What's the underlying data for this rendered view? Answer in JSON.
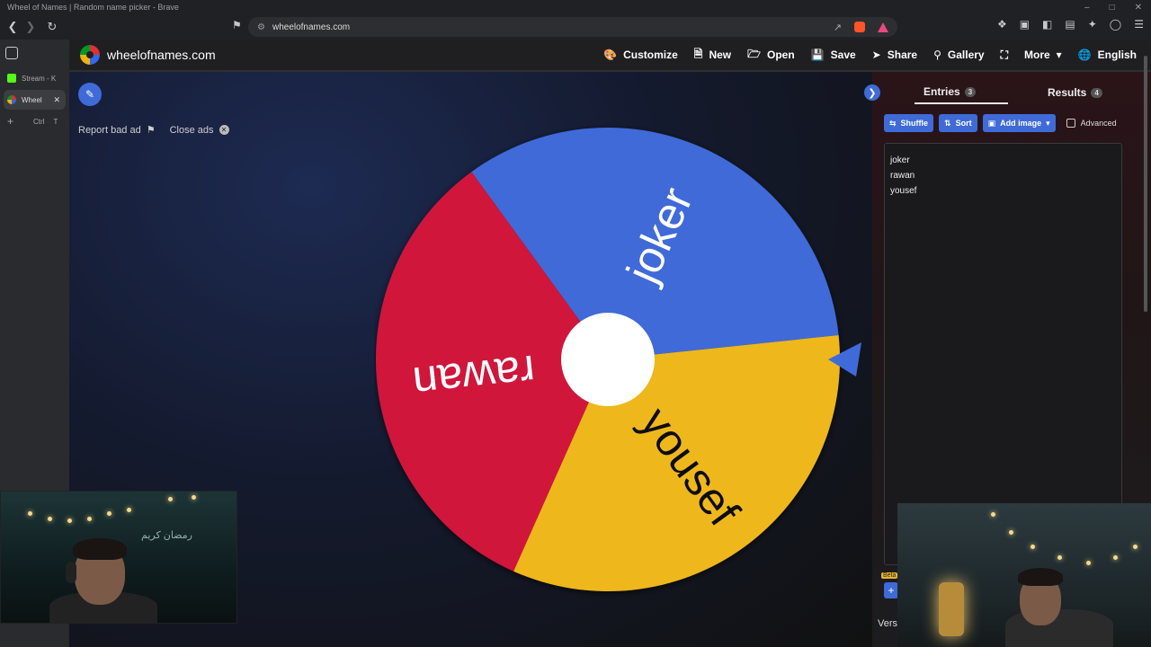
{
  "browser": {
    "window_title": "Wheel of Names | Random name picker - Brave",
    "url": "wheelofnames.com",
    "side_tabs": [
      {
        "label": "Stream - K",
        "color": "#53fc18"
      },
      {
        "label": "Wheel",
        "color": "#3369e8"
      }
    ],
    "new_tab_shortcut_ctrl": "Ctrl",
    "new_tab_shortcut_key": "T"
  },
  "site": {
    "name": "wheelofnames.com",
    "menu": [
      {
        "label": "Customize",
        "icon": "palette-icon"
      },
      {
        "label": "New",
        "icon": "file-icon"
      },
      {
        "label": "Open",
        "icon": "folder-icon"
      },
      {
        "label": "Save",
        "icon": "save-icon"
      },
      {
        "label": "Share",
        "icon": "share-icon"
      },
      {
        "label": "Gallery",
        "icon": "search-icon"
      },
      {
        "label": "More",
        "icon": "fullscreen-icon"
      },
      {
        "label": "English",
        "icon": "globe-icon"
      }
    ],
    "report_ad": "Report bad ad",
    "close_ads": "Close ads"
  },
  "wheel": {
    "segments": [
      {
        "label": "joker",
        "color": "#3f6bd8"
      },
      {
        "label": "yousef",
        "color": "#eeb71e"
      },
      {
        "label": "rawan",
        "color": "#d0143a"
      }
    ],
    "center_color": "#ffffff",
    "pointer_color": "#3f6bd8"
  },
  "panel": {
    "entries_tab": "Entries",
    "entries_count": "3",
    "results_tab": "Results",
    "results_count": "4",
    "shuffle": "Shuffle",
    "sort": "Sort",
    "add_image": "Add image",
    "advanced": "Advanced",
    "entries": [
      "joker",
      "rawan",
      "yousef"
    ],
    "beta": "Beta",
    "version": "Vers"
  },
  "webcam": {
    "wall_text": "رمضان كريم"
  }
}
